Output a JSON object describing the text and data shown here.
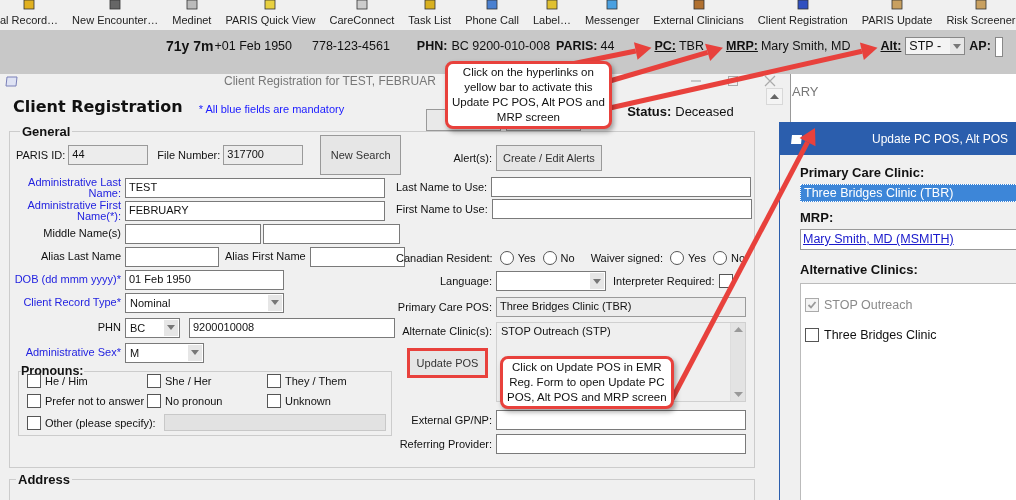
{
  "toolbar": [
    {
      "label": "al Record…"
    },
    {
      "label": "New Encounter…"
    },
    {
      "label": "Medinet"
    },
    {
      "label": "PARIS Quick View"
    },
    {
      "label": "CareConnect"
    },
    {
      "label": "Task List"
    },
    {
      "label": "Phone Call"
    },
    {
      "label": "Label…"
    },
    {
      "label": "Messenger"
    },
    {
      "label": "External Clinicians"
    },
    {
      "label": "Client Registration"
    },
    {
      "label": "PARIS Update"
    },
    {
      "label": "Risk Screener"
    }
  ],
  "patient_bar": {
    "items": [
      {
        "kind": "bold",
        "text": "71y 7m"
      },
      {
        "kind": "text",
        "text": "+01 Feb 1950"
      },
      {
        "kind": "text",
        "text": "778-123-4561"
      },
      {
        "kind": "bold",
        "text": "PHN:"
      },
      {
        "kind": "text",
        "text": "BC 9200-010-008"
      },
      {
        "kind": "bold",
        "text": "PARIS:"
      },
      {
        "kind": "text",
        "text": "44"
      },
      {
        "kind": "link",
        "text": "PC:"
      },
      {
        "kind": "text",
        "text": "TBR"
      },
      {
        "kind": "link",
        "text": "MRP:"
      },
      {
        "kind": "text",
        "text": "Mary Smith, MD"
      },
      {
        "kind": "link",
        "text": "Alt:"
      },
      {
        "kind": "dropdown",
        "text": "STP -"
      },
      {
        "kind": "bold",
        "text": "AP:"
      },
      {
        "kind": "field"
      }
    ]
  },
  "registration_window": {
    "title": "Client Registration for TEST, FEBRUAR",
    "heading": "Client Registration",
    "note": "* All blue fields are mandatory",
    "status_label": "Status:",
    "status": "Deceased",
    "general": {
      "title": "General",
      "left_rows": [
        [
          {
            "kind": "label",
            "text": "PARIS ID:",
            "mandatory": false
          },
          {
            "kind": "input",
            "value": "44",
            "readonly": true
          },
          {
            "kind": "label",
            "text": "File Number:",
            "mandatory": false
          },
          {
            "kind": "input",
            "value": "317700",
            "readonly": true
          },
          {
            "kind": "button",
            "label": "New Search",
            "highlighted": false
          }
        ],
        [
          {
            "kind": "label",
            "text": "Administrative Last Name:",
            "mandatory": true
          },
          {
            "kind": "input",
            "value": "TEST",
            "readonly": false
          }
        ],
        [
          {
            "kind": "label",
            "text": "Administrative First Name(*):",
            "mandatory": true
          },
          {
            "kind": "input",
            "value": "FEBRUARY",
            "readonly": false
          }
        ],
        [
          {
            "kind": "label",
            "text": "Middle Name(s)",
            "mandatory": false
          },
          {
            "kind": "input",
            "readonly": false
          },
          {
            "kind": "input",
            "readonly": false
          }
        ],
        [
          {
            "kind": "label",
            "text": "Alias Last Name",
            "mandatory": false
          },
          {
            "kind": "input",
            "readonly": false
          },
          {
            "kind": "label",
            "text": "Alias First Name",
            "mandatory": false
          },
          {
            "kind": "input",
            "readonly": false
          }
        ],
        [
          {
            "kind": "label",
            "text": "DOB (dd mmm yyyy)*",
            "mandatory": true
          },
          {
            "kind": "input",
            "value": "01 Feb 1950",
            "readonly": false
          }
        ],
        [
          {
            "kind": "label",
            "text": "Client Record Type*",
            "mandatory": true
          },
          {
            "kind": "select",
            "value": "Nominal"
          }
        ],
        [
          {
            "kind": "label",
            "text": "PHN",
            "mandatory": false
          },
          {
            "kind": "select",
            "value": "BC"
          },
          {
            "kind": "input",
            "value": "9200010008",
            "readonly": false
          }
        ],
        [
          {
            "kind": "label",
            "text": "Administrative Sex*",
            "mandatory": true
          },
          {
            "kind": "select",
            "value": "M"
          }
        ]
      ],
      "pronouns": {
        "title": "Pronouns:",
        "options": [
          {
            "label": "He / Him",
            "checked": false
          },
          {
            "label": "She / Her",
            "checked": false
          },
          {
            "label": "They / Them",
            "checked": false
          },
          {
            "label": "Prefer not to answer",
            "checked": false
          },
          {
            "label": "No pronoun",
            "checked": false
          },
          {
            "label": "Unknown",
            "checked": false
          }
        ],
        "other": {
          "label": "Other (please specify):",
          "checked": false,
          "disabled": true
        }
      },
      "right_rows": [
        [
          {
            "kind": "label",
            "text": "Alert(s):",
            "mandatory": false
          },
          {
            "kind": "button",
            "label": "Create / Edit Alerts",
            "highlighted": false
          }
        ],
        [
          {
            "kind": "label",
            "text": "Last Name to Use:",
            "mandatory": false
          },
          {
            "kind": "input",
            "readonly": false
          }
        ],
        [
          {
            "kind": "label",
            "text": "First Name to Use:",
            "mandatory": false
          },
          {
            "kind": "input",
            "readonly": false
          }
        ],
        [
          {
            "kind": "label",
            "text": "Canadian Resident:",
            "mandatory": false
          },
          {
            "kind": "radio",
            "label": "Yes",
            "selected": false
          },
          {
            "kind": "radio",
            "label": "No",
            "selected": false
          },
          {
            "kind": "label",
            "text": "Waiver signed:",
            "mandatory": false
          },
          {
            "kind": "radio",
            "label": "Yes",
            "selected": false
          },
          {
            "kind": "radio",
            "label": "No",
            "selected": false
          }
        ],
        [
          {
            "kind": "label",
            "text": "Language:",
            "mandatory": false
          },
          {
            "kind": "select"
          },
          {
            "kind": "label",
            "text": "Interpreter Required:",
            "mandatory": false
          },
          {
            "kind": "checkbox",
            "checked": false
          }
        ],
        [
          {
            "kind": "label",
            "text": "Primary Care POS:",
            "mandatory": false
          },
          {
            "kind": "input",
            "value": "Three Bridges Clinic (TBR)",
            "readonly": true
          }
        ],
        [
          {
            "kind": "label",
            "text": "Alternate Clinic(s):",
            "mandatory": false
          },
          {
            "kind": "button",
            "label": "Update POS",
            "highlighted": true
          },
          {
            "kind": "list",
            "items": [
              "STOP Outreach (STP)"
            ]
          }
        ],
        [
          {
            "kind": "label",
            "text": "External GP/NP:",
            "mandatory": false
          },
          {
            "kind": "input",
            "readonly": false
          }
        ],
        [
          {
            "kind": "label",
            "text": "Referring Provider:",
            "mandatory": false
          },
          {
            "kind": "input",
            "readonly": false
          }
        ]
      ]
    },
    "address": {
      "title": "Address"
    }
  },
  "background_window": {
    "title": "ARY"
  },
  "update_window": {
    "title": "Update PC POS, Alt POS",
    "primary_label": "Primary Care Clinic:",
    "primary": "Three Bridges Clinic (TBR)",
    "mrp_label": "MRP:",
    "mrp": "Mary Smith, MD (MSMITH)",
    "alt_label": "Alternative Clinics:",
    "clinics": [
      {
        "label": "STOP Outreach",
        "checked": true,
        "disabled": true
      },
      {
        "label": "Three Bridges Clinic",
        "checked": false,
        "disabled": false
      }
    ]
  },
  "callouts": [
    {
      "lines": [
        "Click on the hyperlinks on",
        "yellow bar to activate this",
        "Update PC POS, Alt POS and",
        "MRP screen"
      ]
    },
    {
      "lines": [
        "Click on Update POS in EMR",
        "Reg. Form to open Update PC",
        "POS, Alt POS and MRP screen"
      ]
    }
  ]
}
